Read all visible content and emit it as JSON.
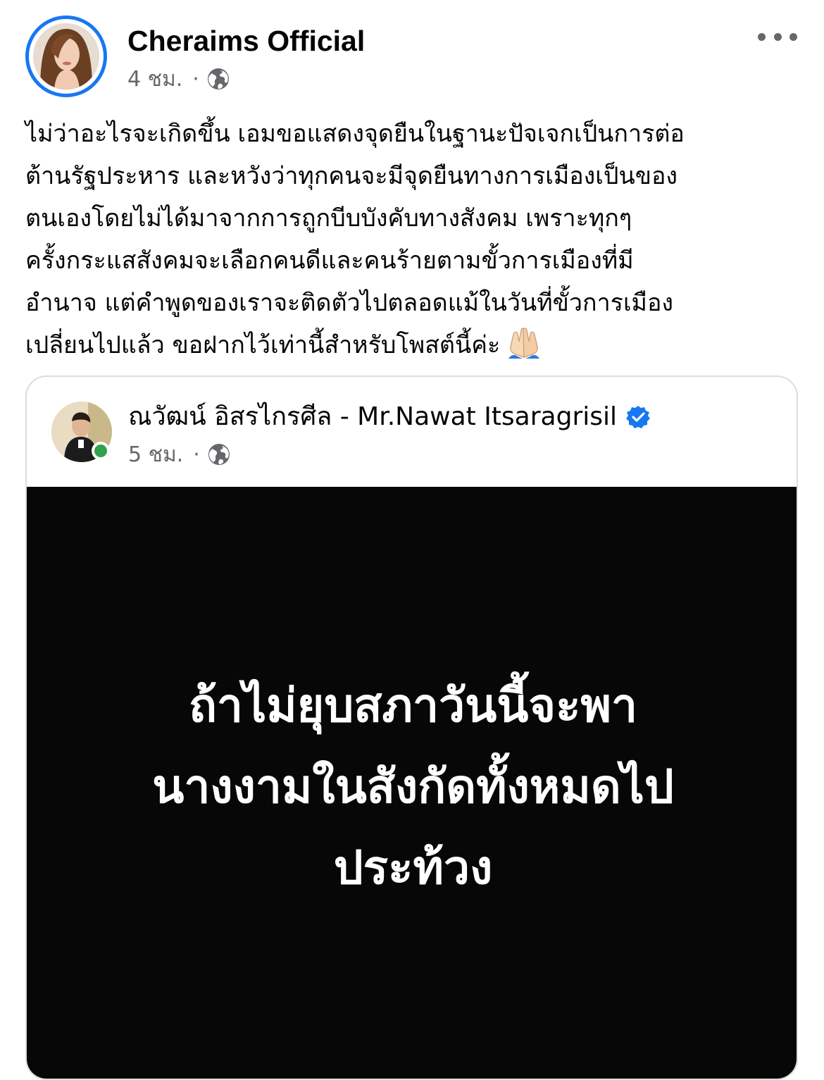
{
  "post": {
    "author": "Cheraims Official",
    "time": "4 ชม.",
    "separator": "·",
    "privacy_icon": "globe-icon",
    "more_icon": "more-options-icon",
    "text_lines": [
      "ไม่ว่าอะไรจะเกิดขึ้น เอมขอแสดงจุดยืนในฐานะปัจเจกเป็นการต่อ",
      "ต้านรัฐประหาร และหวังว่าทุกคนจะมีจุดยืนทางการเมืองเป็นของ",
      "ตนเองโดยไม่ได้มาจากการถูกบีบบังคับทางสังคม เพราะทุกๆ",
      "ครั้งกระแสสังคมจะเลือกคนดีและคนร้ายตามขั้วการเมืองที่มี",
      "อำนาจ แต่คำพูดของเราจะติดตัวไปตลอดแม้ในวันที่ขั้วการเมือง",
      "เปลี่ยนไปแล้ว ขอฝากไว้เท่านี้สำหรับโพสต์นี้ค่ะ"
    ],
    "emoji_icon": "folded-hands-icon"
  },
  "shared_post": {
    "author": "ณวัฒน์ อิสรไกรศีล - Mr.Nawat Itsaragrisil",
    "verified_icon": "verified-badge-icon",
    "time": "5 ชม.",
    "separator": "·",
    "privacy_icon": "globe-icon",
    "online_status": "online",
    "image_text_lines": [
      "ถ้าไม่ยุบสภาวันนี้จะพา",
      "นางงามในสังกัดทั้งหมดไป",
      "ประท้วง"
    ]
  },
  "colors": {
    "accent_blue": "#1877f2",
    "secondary_text": "#65676b",
    "online_green": "#31a24c",
    "image_background": "#070707"
  }
}
